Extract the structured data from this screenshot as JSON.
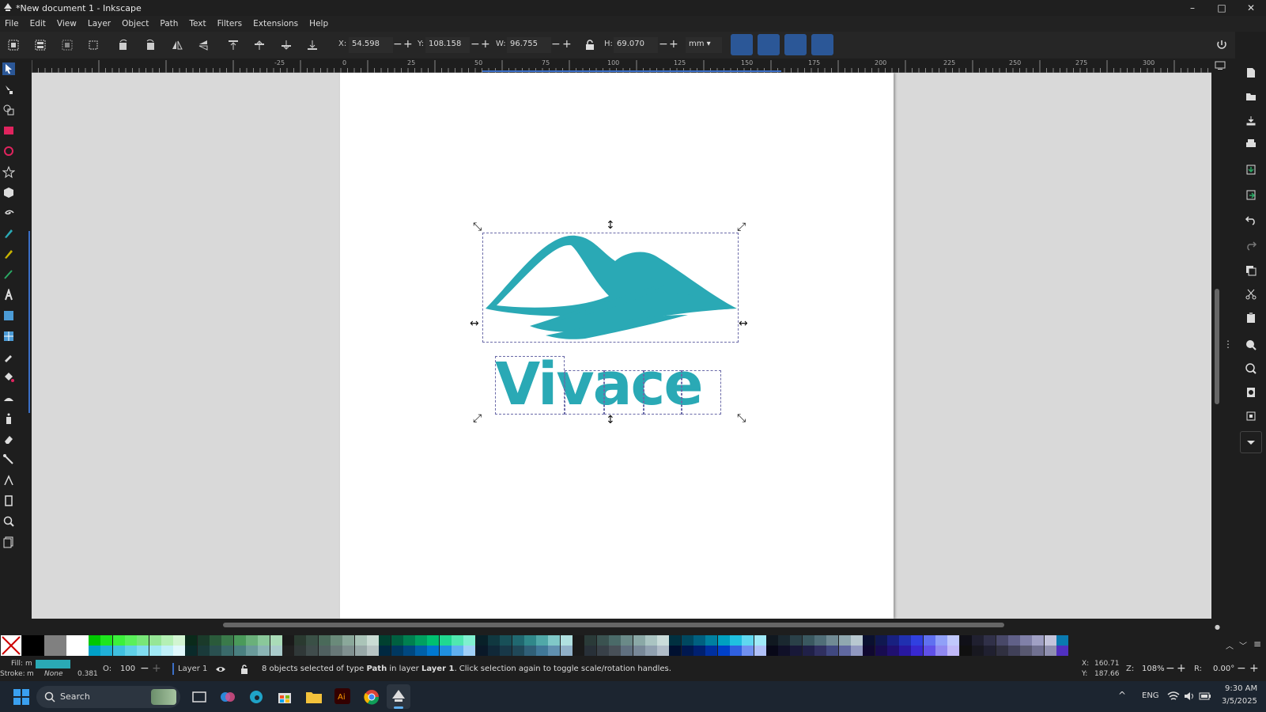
{
  "window": {
    "title": "*New document 1 - Inkscape"
  },
  "window_controls": {
    "minimize": "–",
    "maximize": "□",
    "close": "✕"
  },
  "menu": [
    "File",
    "Edit",
    "View",
    "Layer",
    "Object",
    "Path",
    "Text",
    "Filters",
    "Extensions",
    "Help"
  ],
  "toolbar": {
    "x_label": "X:",
    "x_value": "54.598",
    "y_label": "Y:",
    "y_value": "108.158",
    "w_label": "W:",
    "w_value": "96.755",
    "h_label": "H:",
    "h_value": "69.070",
    "units": "mm",
    "minus": "−",
    "plus": "+"
  },
  "ruler": {
    "labels": [
      "-25",
      "0",
      "25",
      "50",
      "75",
      "100",
      "125",
      "150",
      "175",
      "200",
      "225",
      "250",
      "275",
      "300"
    ]
  },
  "logo": {
    "text": "Vivace",
    "color": "#2aa9b5"
  },
  "status": {
    "fill_label": "Fill:",
    "fill_value": "m",
    "stroke_label": "Stroke:",
    "stroke_value": "m",
    "stroke_none": "None",
    "stroke_width": "0.381",
    "opacity_label": "O:",
    "opacity_value": "100",
    "layer": "Layer 1",
    "message_prefix": "8 objects selected of type ",
    "message_type": "Path",
    "message_mid": " in layer ",
    "message_layer": "Layer 1",
    "message_suffix": ". Click selection again to toggle scale/rotation handles.",
    "cursor_x_label": "X:",
    "cursor_x": "160.71",
    "cursor_y_label": "Y:",
    "cursor_y": "187.66",
    "zoom_label": "Z:",
    "zoom": "108%",
    "rotation_label": "R:",
    "rotation": "0.00°"
  },
  "taskbar": {
    "search_placeholder": "Search",
    "lang": "ENG",
    "time": "9:30 AM",
    "date": "3/5/2025"
  },
  "colors": {
    "accent_blue": "#2b5797",
    "logo_teal": "#2aa9b5"
  }
}
